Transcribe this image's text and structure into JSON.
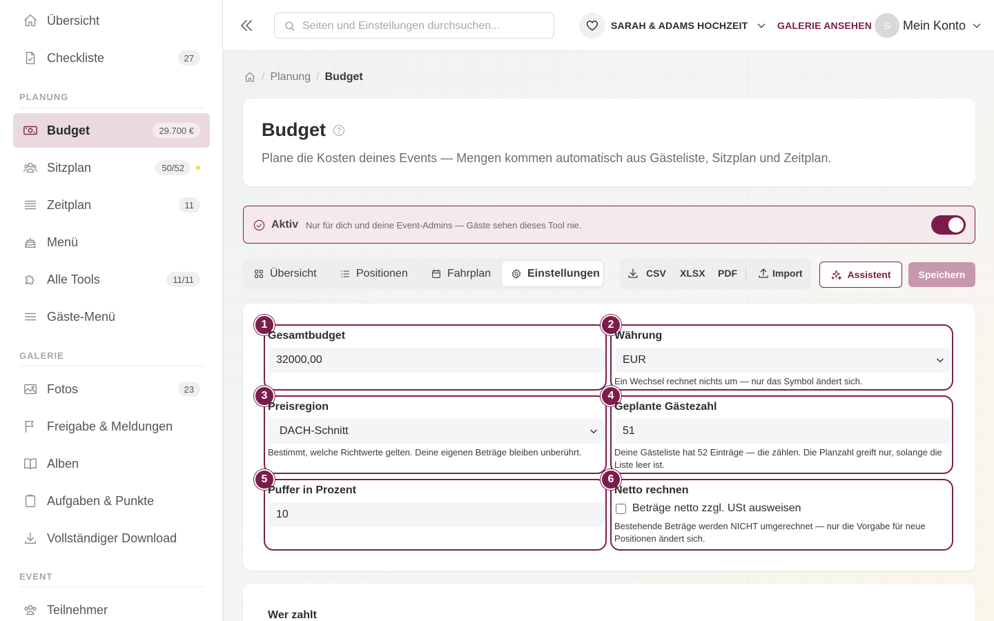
{
  "sidebar": {
    "top_items": [
      {
        "label": "Übersicht",
        "icon": "home-icon"
      },
      {
        "label": "Checkliste",
        "icon": "checklist-icon",
        "badge": "27"
      }
    ],
    "sections": {
      "planung": "PLANUNG",
      "galerie": "GALERIE",
      "event": "EVENT"
    },
    "planung_items": [
      {
        "label": "Budget",
        "icon": "money-icon",
        "badge": "29.700 €",
        "active": true
      },
      {
        "label": "Sitzplan",
        "icon": "people-icon",
        "badge": "50/52",
        "dot": true
      },
      {
        "label": "Zeitplan",
        "icon": "timeline-icon",
        "badge": "11"
      },
      {
        "label": "Menü",
        "icon": "cake-icon"
      },
      {
        "label": "Alle Tools",
        "icon": "puzzle-icon",
        "badge": "11/11"
      },
      {
        "label": "Gäste-Menü",
        "icon": "menu-icon"
      }
    ],
    "galerie_items": [
      {
        "label": "Fotos",
        "icon": "image-icon",
        "badge": "23"
      },
      {
        "label": "Freigabe & Meldungen",
        "icon": "flag-icon"
      },
      {
        "label": "Alben",
        "icon": "book-icon"
      },
      {
        "label": "Aufgaben & Punkte",
        "icon": "clipboard-icon"
      },
      {
        "label": "Vollständiger Download",
        "icon": "download-icon"
      }
    ],
    "event_items": [
      {
        "label": "Teilnehmer",
        "icon": "people-icon"
      }
    ]
  },
  "topbar": {
    "search_placeholder": "Seiten und Einstellungen durchsuchen...",
    "event_name": "SARAH & ADAMS HOCHZEIT",
    "gallery_link": "GALERIE ANSEHEN",
    "avatar_initial": "S",
    "account_label": "Mein Konto"
  },
  "breadcrumb": {
    "items": [
      "Planung",
      "Budget"
    ]
  },
  "page": {
    "title": "Budget",
    "subtitle": "Plane die Kosten deines Events — Mengen kommen automatisch aus Gästeliste, Sitzplan und Zeitplan."
  },
  "banner": {
    "title": "Aktiv",
    "description": "Nur für dich und deine Event-Admins — Gäste sehen dieses Tool nie.",
    "toggle_on": true
  },
  "tabs": [
    {
      "label": "Übersicht",
      "icon": "grid-icon"
    },
    {
      "label": "Positionen",
      "icon": "list-icon"
    },
    {
      "label": "Fahrplan",
      "icon": "calendar-icon"
    },
    {
      "label": "Einstellungen",
      "icon": "gear-icon",
      "active": true
    }
  ],
  "export": {
    "csv": "CSV",
    "xlsx": "XLSX",
    "pdf": "PDF",
    "import": "Import"
  },
  "actions": {
    "assistant": "Assistent",
    "save": "Speichern"
  },
  "settings": {
    "fields": [
      {
        "num": "1",
        "label": "Gesamtbudget",
        "value": "32000,00"
      },
      {
        "num": "2",
        "label": "Währung",
        "value": "EUR",
        "help": "Ein Wechsel rechnet nichts um — nur das Symbol ändert sich."
      },
      {
        "num": "3",
        "label": "Preisregion",
        "value": "DACH-Schnitt",
        "help": "Bestimmt, welche Richtwerte gelten. Deine eigenen Beträge bleiben unberührt."
      },
      {
        "num": "4",
        "label": "Geplante Gästezahl",
        "value": "51",
        "help": "Deine Gästeliste hat 52 Einträge — die zählen. Die Planzahl greift nur, solange die Liste leer ist."
      },
      {
        "num": "5",
        "label": "Puffer in Prozent",
        "value": "10"
      },
      {
        "num": "6",
        "label": "Netto rechnen",
        "checkbox_label": "Beträge netto zzgl. USt ausweisen",
        "checked": false,
        "help": "Bestehende Beträge werden NICHT umgerechnet — nur die Vorgabe für neue Positionen ändert sich."
      }
    ]
  },
  "second_card": {
    "title": "Wer zahlt"
  },
  "colors": {
    "accent": "#7b1d4a",
    "active_bg": "#ead9de",
    "save_disabled": "#c798ad"
  }
}
